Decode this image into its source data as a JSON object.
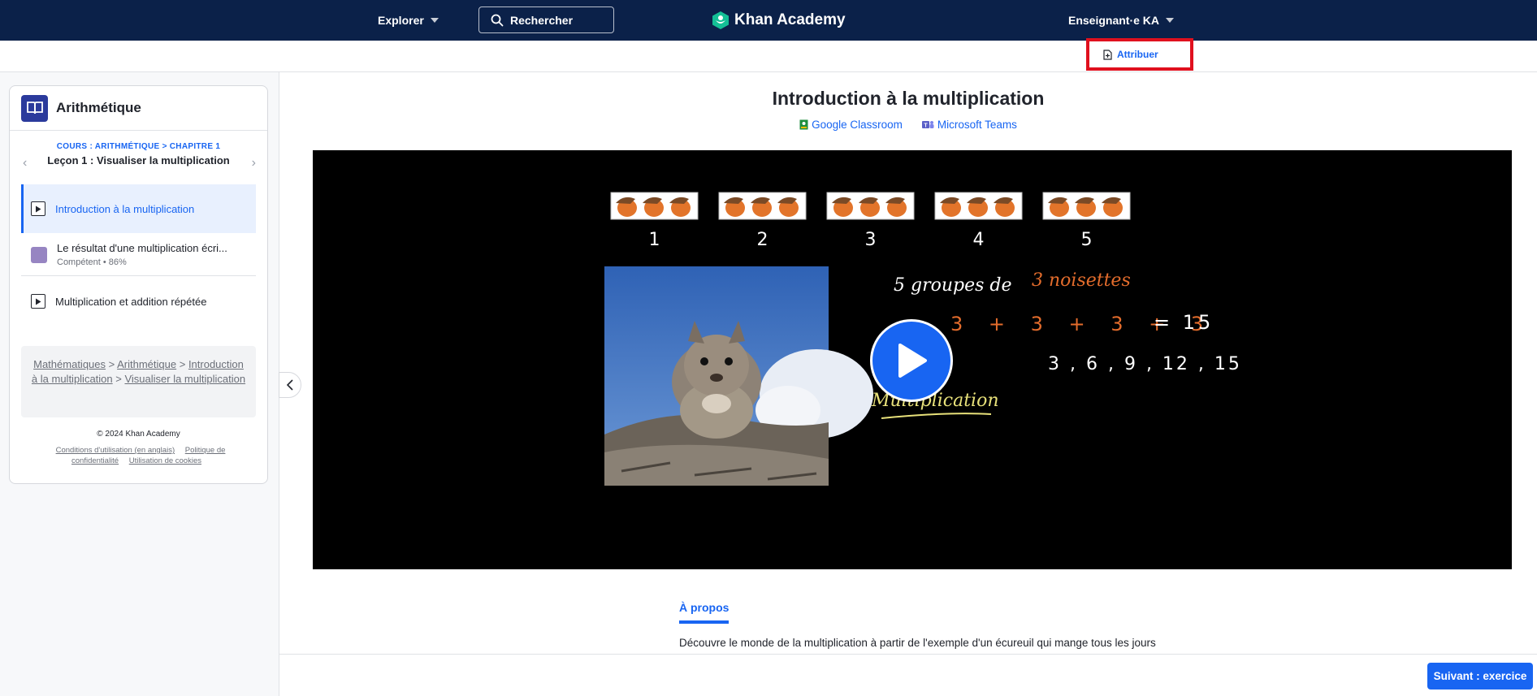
{
  "nav": {
    "explore_label": "Explorer",
    "search_label": "Rechercher",
    "logo_text": "Khan Academy",
    "user_label": "Enseignant·e KA"
  },
  "toolbar": {
    "assign_label": "Attribuer"
  },
  "sidebar": {
    "course_title": "Arithmétique",
    "lesson_crumbs": "COURS : ARITHMÉTIQUE > CHAPITRE 1",
    "lesson_name": "Leçon 1 : Visualiser la multiplication",
    "items": [
      {
        "label": "Introduction à la multiplication",
        "type": "video",
        "active": true
      },
      {
        "label": "Le résultat d'une multiplication écri...",
        "sub": "Compétent • 86%",
        "type": "exercise"
      },
      {
        "label": "Multiplication et addition répétée",
        "type": "video"
      }
    ],
    "breadcrumbs": [
      "Mathématiques",
      "Arithmétique",
      "Introduction à la multiplication",
      "Visualiser la multiplication"
    ],
    "copyright": "© 2024 Khan Academy",
    "footer_links": [
      "Conditions d'utilisation (en anglais)",
      "Politique de confidentialité",
      "Utilisation de cookies"
    ]
  },
  "main": {
    "title": "Introduction à la multiplication",
    "share": [
      "Google Classroom",
      "Microsoft Teams"
    ],
    "video": {
      "group_numbers": [
        "1",
        "2",
        "3",
        "4",
        "5"
      ],
      "line1_a": "5 groupes de",
      "line1_b": "3 noisettes",
      "equation_terms": "3 + 3 + 3 + 3",
      "equation_result": "= 15",
      "sequence": "3 , 6 , 9 , 12 , 15",
      "word": "Multiplication"
    },
    "tab_about": "À propos",
    "about_text": "Découvre le monde de la multiplication à partir de l'exemple d'un écureuil qui mange tous les jours",
    "next_label": "Suivant : exercice"
  },
  "colors": {
    "nav_bg": "#0b2149",
    "accent": "#1865f2",
    "highlight": "#e0101e"
  }
}
